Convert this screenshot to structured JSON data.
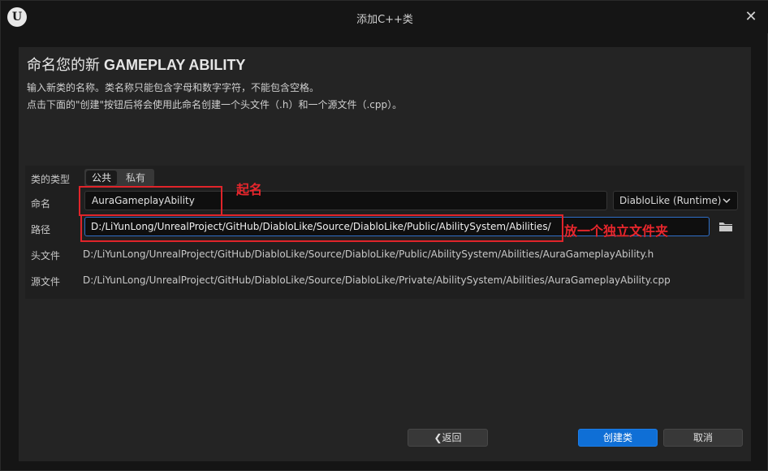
{
  "window": {
    "title": "添加C++类",
    "logo_letter": "U"
  },
  "header": {
    "heading_prefix": "命名您的新",
    "heading_class": "GAMEPLAY ABILITY",
    "desc_line1": "输入新类的名称。类名称只能包含字母和数字字符，不能包含空格。",
    "desc_line2": "点击下面的\"创建\"按钮后将会使用此命名创建一个头文件（.h）和一个源文件（.cpp）。"
  },
  "form": {
    "class_type_label": "类的类型",
    "class_type_options": [
      "公共",
      "私有"
    ],
    "class_type_selected": "公共",
    "name_label": "命名",
    "name_value": "AuraGameplayAbility",
    "module_value": "DiabloLike (Runtime)",
    "path_label": "路径",
    "path_value": "D:/LiYunLong/UnrealProject/GitHub/DiabloLike/Source/DiabloLike/Public/AbilitySystem/Abilities/",
    "header_label": "头文件",
    "header_value": "D:/LiYunLong/UnrealProject/GitHub/DiabloLike/Source/DiabloLike/Public/AbilitySystem/Abilities/AuraGameplayAbility.h",
    "source_label": "源文件",
    "source_value": "D:/LiYunLong/UnrealProject/GitHub/DiabloLike/Source/DiabloLike/Private/AbilitySystem/Abilities/AuraGameplayAbility.cpp"
  },
  "annotations": {
    "name_note": "起名",
    "path_note": "放一个独立文件夹"
  },
  "buttons": {
    "back": "❮返回",
    "create": "创建类",
    "cancel": "取消"
  },
  "colors": {
    "accent": "#0f6fd6",
    "annotation": "#e0242a",
    "background": "#151515",
    "panel": "#242424"
  },
  "icons": {
    "close": "close-icon",
    "folder": "folder-icon",
    "chevron": "chevron-down-icon"
  }
}
